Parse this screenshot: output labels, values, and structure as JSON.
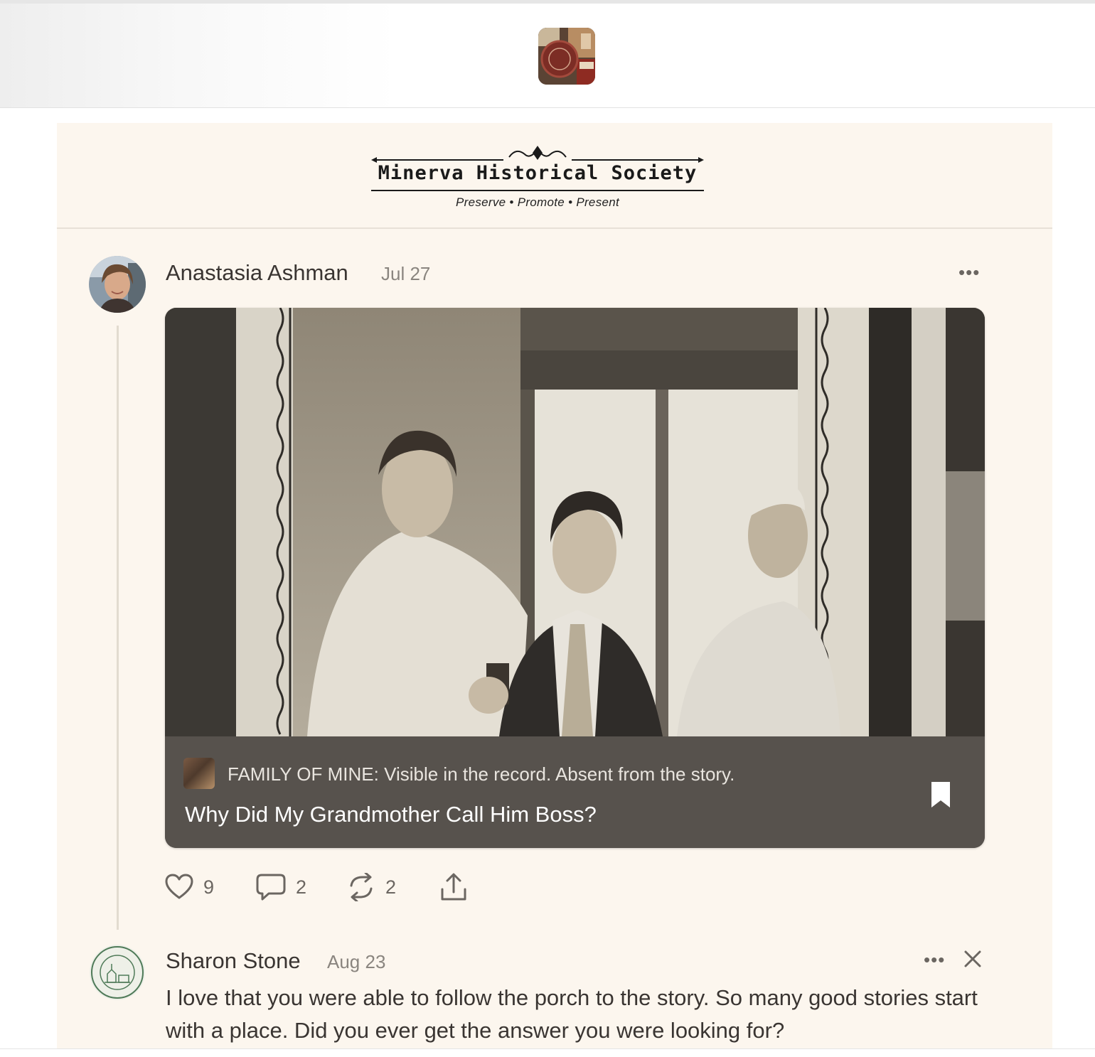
{
  "publication": {
    "name": "Minerva Historical Society",
    "tagline": "Preserve • Promote • Present",
    "icon": "publication-collage-icon"
  },
  "note": {
    "author": "Anastasia Ashman",
    "date": "Jul 27",
    "more_label": "•••",
    "card": {
      "publication_label": "FAMILY OF MINE: Visible in the record. Absent from the story.",
      "title": "Why Did My Grandmother Call Him Boss?",
      "image": "sepia-family-photo"
    },
    "actions": {
      "likes": "9",
      "comments": "2",
      "restacks": "2"
    }
  },
  "reply": {
    "author": "Sharon Stone",
    "date": "Aug 23",
    "more_label": "•••",
    "text": "I love that you were able to follow the porch to the story. So many good stories start with a place. Did you ever get the answer you were looking for?"
  },
  "colors": {
    "panel_bg": "#fcf6ee",
    "card_footer": "#57524d",
    "muted_text": "#8a857f"
  }
}
